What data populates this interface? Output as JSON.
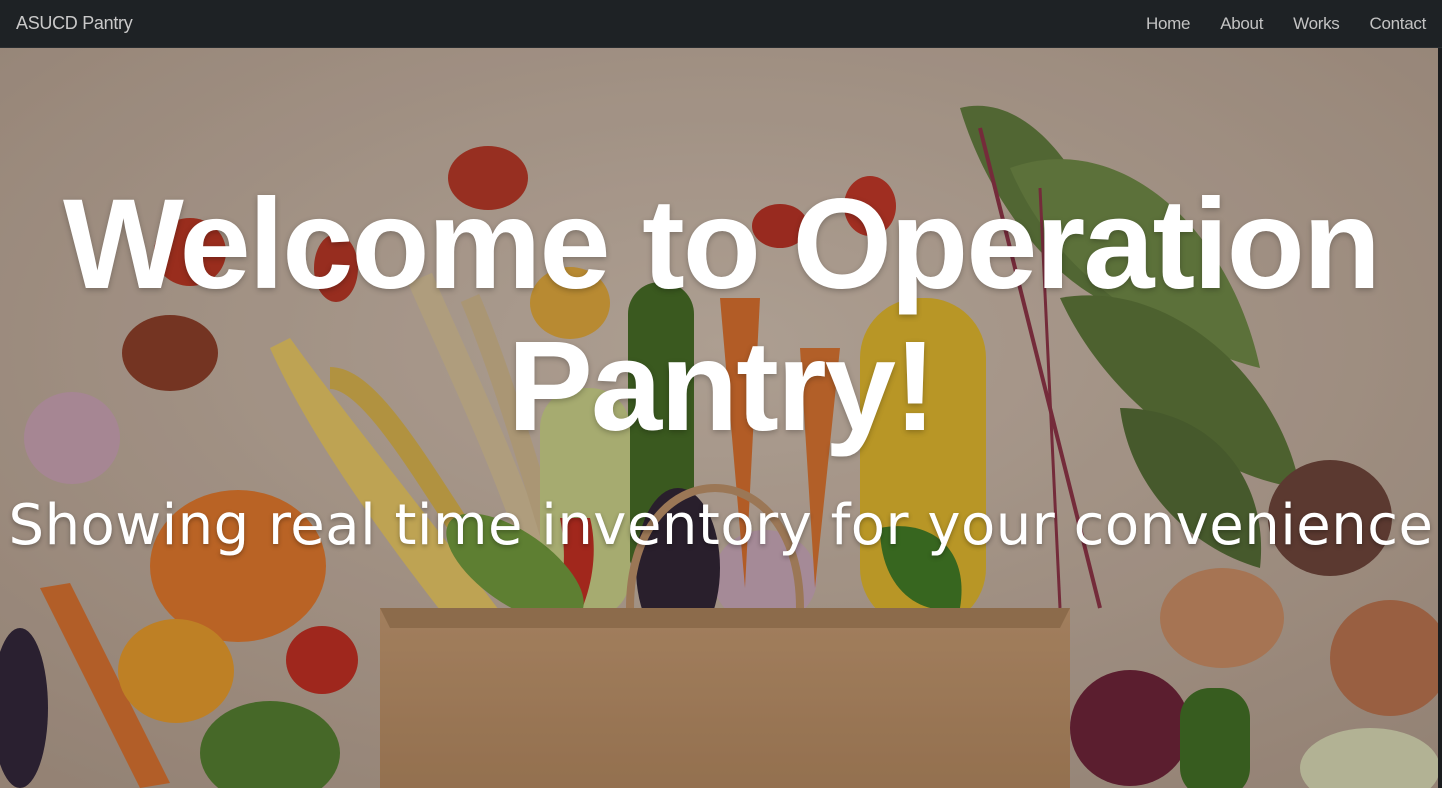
{
  "navbar": {
    "brand": "ASUCD Pantry",
    "links": [
      {
        "label": "Home"
      },
      {
        "label": "About"
      },
      {
        "label": "Works"
      },
      {
        "label": "Contact"
      }
    ]
  },
  "hero": {
    "title_line1": "Welcome to Operation",
    "title_line2": "Pantry!",
    "subtitle": "Showing real time inventory for your convenience",
    "background_image": "vegetables-in-paper-bag"
  },
  "colors": {
    "navbar_bg": "#1e2225",
    "nav_text": "#c3c3c3",
    "hero_text": "#ffffff"
  }
}
